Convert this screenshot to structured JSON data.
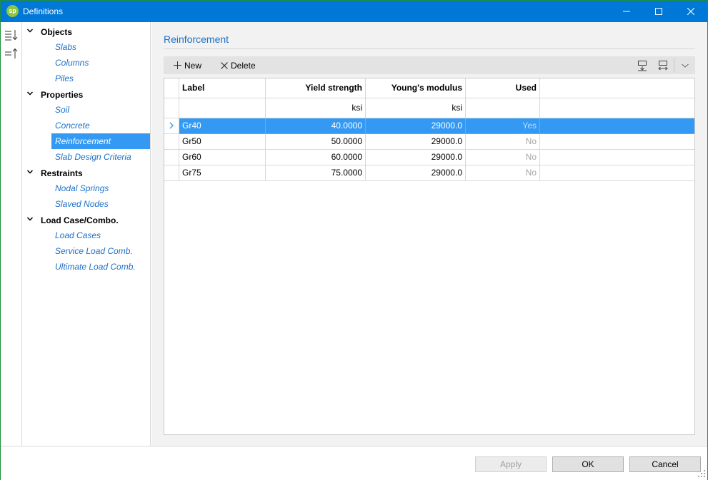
{
  "window": {
    "title": "Definitions",
    "app_icon_text": "sp"
  },
  "tree": {
    "groups": [
      {
        "label": "Objects",
        "items": [
          "Slabs",
          "Columns",
          "Piles"
        ]
      },
      {
        "label": "Properties",
        "items": [
          "Soil",
          "Concrete",
          "Reinforcement",
          "Slab Design Criteria"
        ]
      },
      {
        "label": "Restraints",
        "items": [
          "Nodal Springs",
          "Slaved Nodes"
        ]
      },
      {
        "label": "Load Case/Combo.",
        "items": [
          "Load Cases",
          "Service Load Comb.",
          "Ultimate Load Comb."
        ]
      }
    ],
    "selected": "Reinforcement"
  },
  "main": {
    "section_title": "Reinforcement",
    "toolbar": {
      "new_label": "New",
      "delete_label": "Delete"
    },
    "table": {
      "columns": [
        "Label",
        "Yield strength",
        "Young's modulus",
        "Used"
      ],
      "units": [
        "",
        "ksi",
        "ksi",
        ""
      ],
      "rows": [
        {
          "label": "Gr40",
          "yield": "40.0000",
          "modulus": "29000.0",
          "used": "Yes"
        },
        {
          "label": "Gr50",
          "yield": "50.0000",
          "modulus": "29000.0",
          "used": "No"
        },
        {
          "label": "Gr60",
          "yield": "60.0000",
          "modulus": "29000.0",
          "used": "No"
        },
        {
          "label": "Gr75",
          "yield": "75.0000",
          "modulus": "29000.0",
          "used": "No"
        }
      ],
      "selected_row": 0
    }
  },
  "buttons": {
    "apply": "Apply",
    "ok": "OK",
    "cancel": "Cancel"
  },
  "colors": {
    "accent": "#0078d7",
    "selection": "#3399f3",
    "link": "#1c6fc6"
  }
}
